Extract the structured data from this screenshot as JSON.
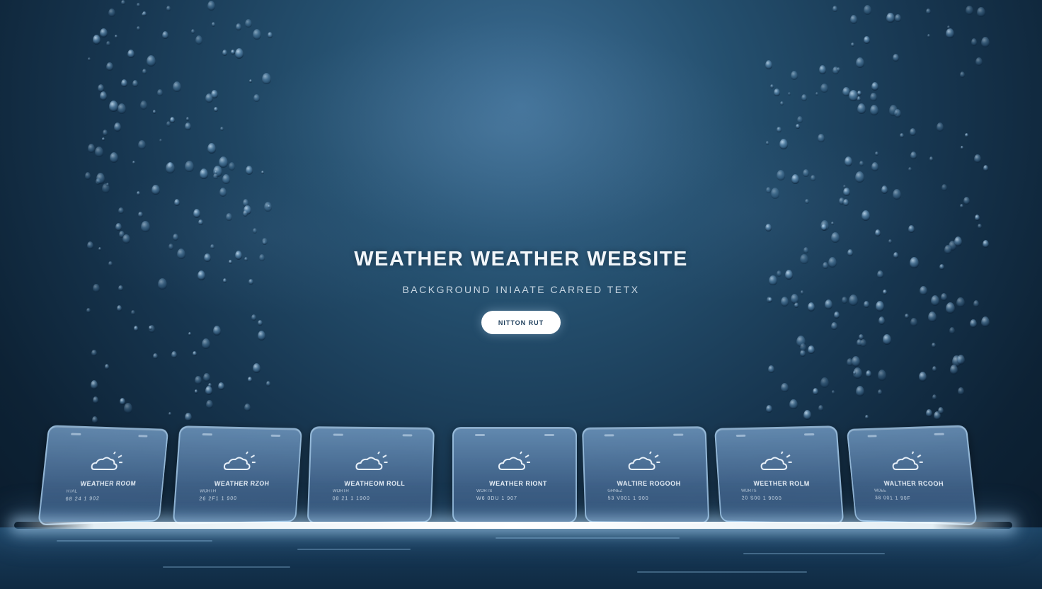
{
  "hero": {
    "title": "WEATHER WEATHER WEBSITE",
    "subtitle": "BACKGROUND INIAATE CARRED TETX",
    "button_label": "NITTON RUT"
  },
  "cards": [
    {
      "title": "WEATHER ROOM",
      "subtitle": "RTAL",
      "stats": "68 24 1 902",
      "icon": "partly-cloudy-icon"
    },
    {
      "title": "WEATHER RZOH",
      "subtitle": "WORTH",
      "stats": "26 2F1 1 900",
      "icon": "partly-cloudy-icon"
    },
    {
      "title": "WEATHEOM ROLL",
      "subtitle": "WORTH",
      "stats": "08 21 1 1900",
      "icon": "partly-cloudy-icon"
    },
    {
      "title": "WEATHER RIONT",
      "subtitle": "WORTS",
      "stats": "W6 0DU 1 907",
      "icon": "partly-cloudy-icon"
    },
    {
      "title": "WALTIRE ROGOOH",
      "subtitle": "GHNEZ",
      "stats": "53 V001 1 900",
      "icon": "partly-cloudy-icon"
    },
    {
      "title": "WEETHER ROLM",
      "subtitle": "WORTS",
      "stats": "20 S00 1 9000",
      "icon": "partly-cloudy-icon"
    },
    {
      "title": "WALTHER RCOOH",
      "subtitle": "WDEE",
      "stats": "38 001 1 90F",
      "icon": "partly-cloudy-icon"
    }
  ],
  "colors": {
    "background_top": "#3e6f96",
    "background_bottom": "#0a1a2a",
    "card_fill": "#5a87b2",
    "card_border": "#aacdeb",
    "glow": "#ffffff",
    "button_text": "#1f3f5c"
  }
}
